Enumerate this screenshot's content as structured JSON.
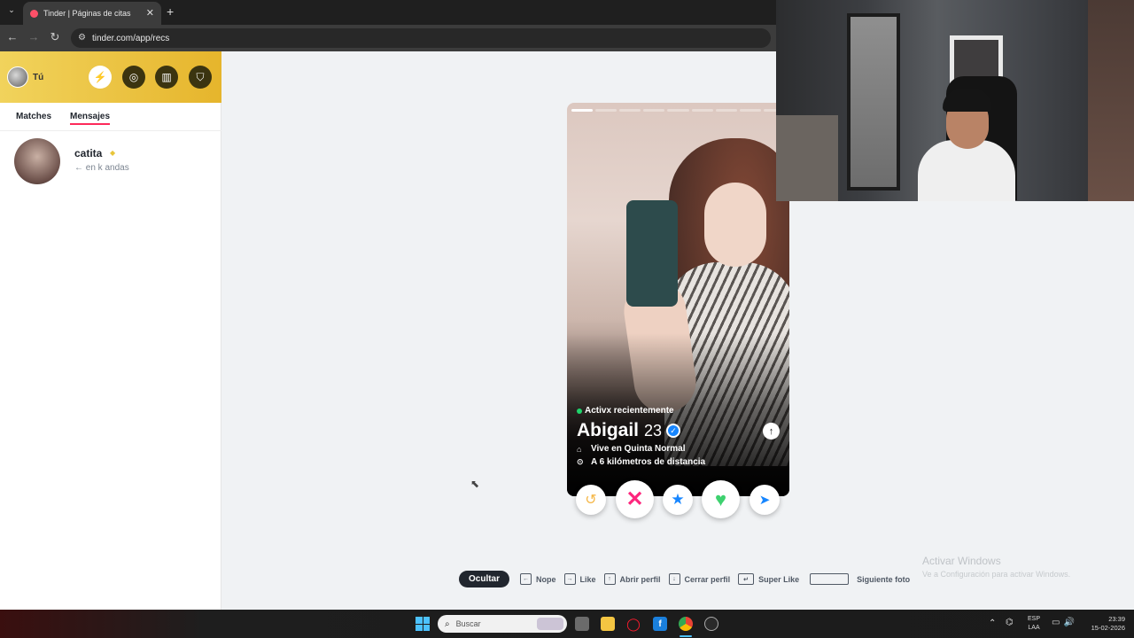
{
  "browser": {
    "tab_title": "Tinder | Páginas de citas",
    "url": "tinder.com/app/recs",
    "new_tab": "+",
    "close": "✕"
  },
  "sidebar": {
    "me_label": "Tú",
    "tabs": [
      {
        "label": "Matches"
      },
      {
        "label": "Mensajes"
      }
    ],
    "messages": [
      {
        "name": "catita",
        "preview": "← en k andas"
      }
    ]
  },
  "profile": {
    "status": "Activx recientemente",
    "name": "Abigail",
    "age": "23",
    "lives_in": "Vive en Quinta Normal",
    "distance": "A 6 kilómetros de distancia",
    "photo_count": 9,
    "current_photo": 1
  },
  "shortcuts": {
    "hide": "Ocultar",
    "nope": "Nope",
    "like": "Like",
    "open_profile": "Abrir perfil",
    "close_profile": "Cerrar perfil",
    "super_like": "Super Like",
    "next_photo": "Siguiente foto"
  },
  "watermark": {
    "title": "Activar Windows",
    "subtitle": "Ve a Configuración para activar Windows."
  },
  "taskbar": {
    "search_placeholder": "Buscar",
    "lang_top": "ESP",
    "lang_bottom": "LAA",
    "time": "23:39",
    "date": "15-02-2026"
  },
  "colors": {
    "tinder_accent": "#fd2a5a",
    "header_gold": "#e6b52c",
    "verified_blue": "#1786ff",
    "like_green": "#3ed16f",
    "nope_pink": "#fd267d"
  }
}
